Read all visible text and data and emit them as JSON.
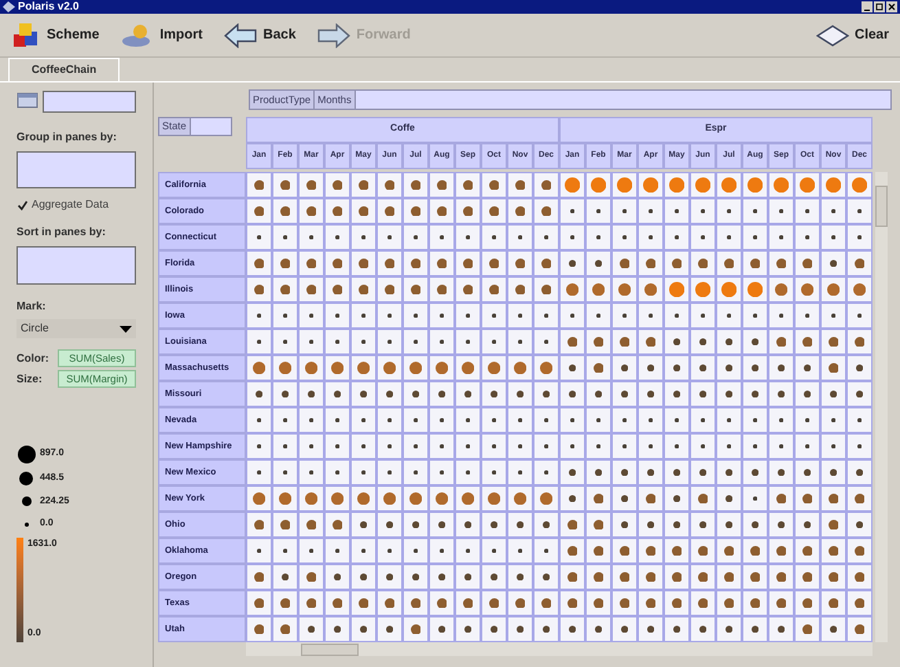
{
  "window": {
    "title": "Polaris v2.0"
  },
  "toolbar": [
    {
      "label": "Scheme",
      "kind": "scheme",
      "disabled": false
    },
    {
      "label": "Import",
      "kind": "import",
      "disabled": false
    },
    {
      "label": "Back",
      "kind": "back",
      "disabled": false
    },
    {
      "label": "Forward",
      "kind": "forward",
      "disabled": true
    },
    {
      "label": "Clear",
      "kind": "clear",
      "disabled": false
    }
  ],
  "tabs": [
    {
      "label": "CoffeeChain",
      "selected": true
    }
  ],
  "left_panel": {
    "group_label": "Group in panes by:",
    "aggregate": {
      "label": "Aggregate Data",
      "checked": true
    },
    "sort_label": "Sort in panes by:",
    "mark_label": "Mark:",
    "mark_value": "Circle",
    "encodings": [
      {
        "label": "Color:",
        "field": "SUM(Sales)"
      },
      {
        "label": "Size:",
        "field": "SUM(Margin)"
      }
    ],
    "size_legend": [
      {
        "label": "897.0",
        "kind": "xl"
      },
      {
        "label": "448.5",
        "kind": "l"
      },
      {
        "label": "224.25",
        "kind": "m"
      },
      {
        "label": "0.0",
        "kind": "s"
      }
    ],
    "color_legend": {
      "max": "1631.0",
      "min": "0.0"
    }
  },
  "column_shelf": [
    "ProductType",
    "Months"
  ],
  "row_shelf": [
    "State"
  ],
  "grid": {
    "groups": [
      {
        "label": "Coffe",
        "months": [
          "Jan",
          "Feb",
          "Mar",
          "Apr",
          "May",
          "Jun",
          "Jul",
          "Aug",
          "Sep",
          "Oct",
          "Nov",
          "Dec"
        ]
      },
      {
        "label": "Espr",
        "months": [
          "Jan",
          "Feb",
          "Mar",
          "Apr",
          "May",
          "Jun",
          "Jul",
          "Aug",
          "Sep",
          "Oct",
          "Nov",
          "Dec"
        ]
      }
    ],
    "rows": [
      "California",
      "Colorado",
      "Connecticut",
      "Florida",
      "Illinois",
      "Iowa",
      "Louisiana",
      "Massachusetts",
      "Missouri",
      "Nevada",
      "New Hampshire",
      "New Mexico",
      "New York",
      "Ohio",
      "Oklahoma",
      "Oregon",
      "Texas",
      "Utah"
    ]
  }
}
